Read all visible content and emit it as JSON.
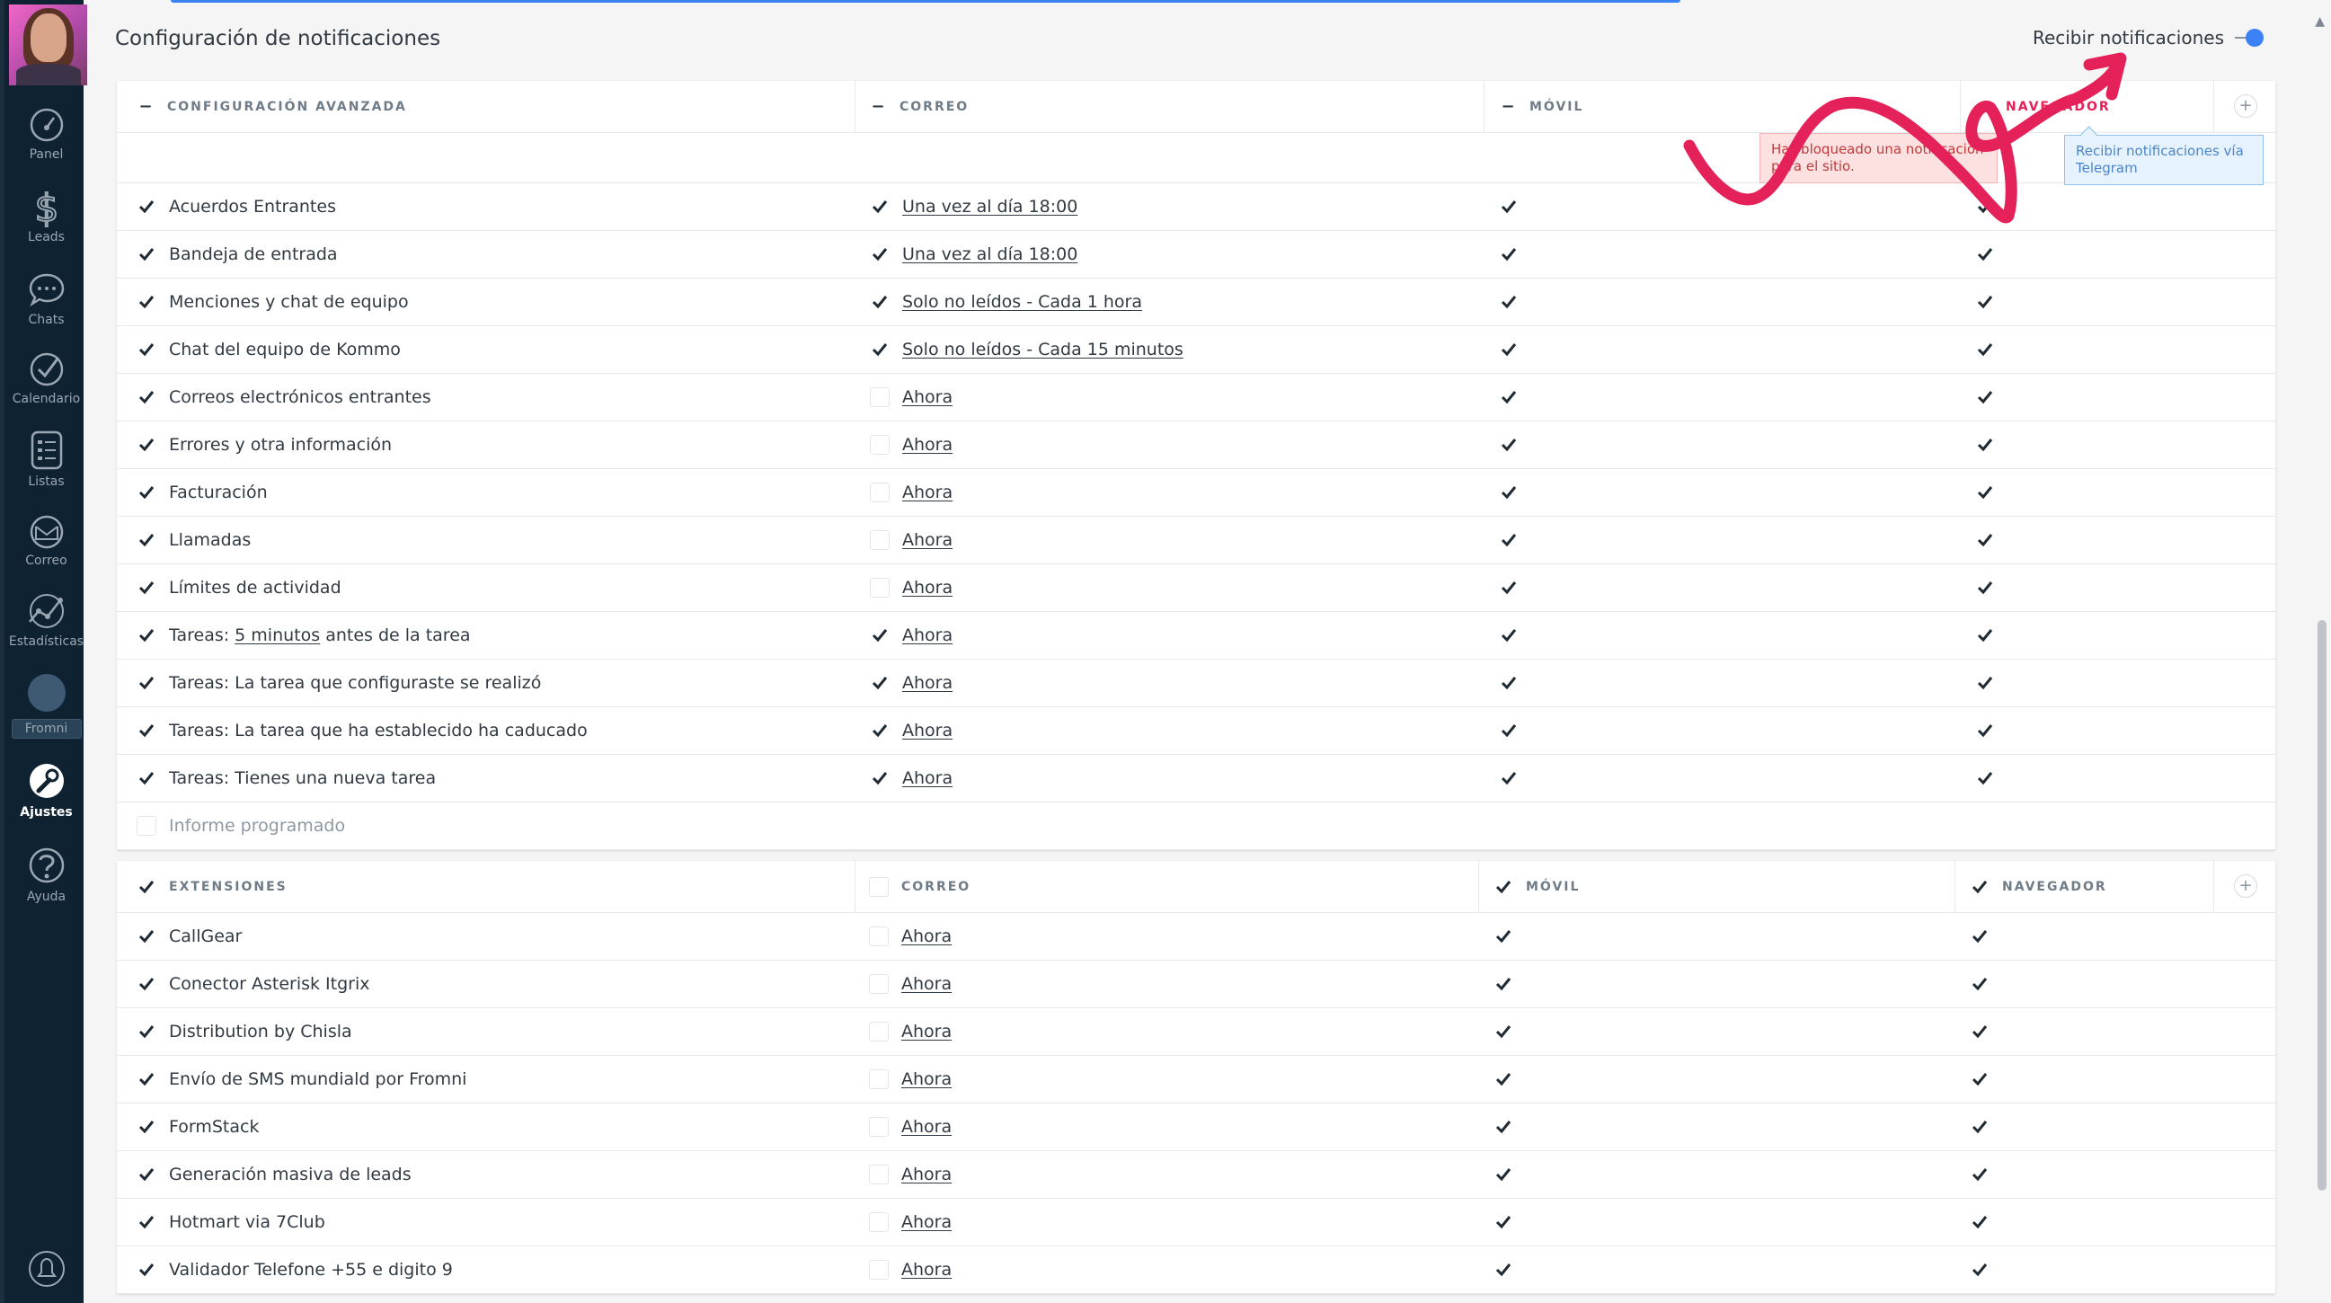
{
  "sidebar": {
    "items": [
      {
        "label": "Panel",
        "icon": "gauge-icon"
      },
      {
        "label": "Leads",
        "icon": "dollar-icon"
      },
      {
        "label": "Chats",
        "icon": "chat-icon"
      },
      {
        "label": "Calendario",
        "icon": "check-circle-icon"
      },
      {
        "label": "Listas",
        "icon": "list-icon"
      },
      {
        "label": "Correo",
        "icon": "mail-icon"
      },
      {
        "label": "Estadísticas",
        "icon": "stats-icon"
      },
      {
        "label": "Fromni",
        "icon": "fromni-icon"
      },
      {
        "label": "Ajustes",
        "icon": "wrench-icon",
        "active": true
      },
      {
        "label": "Ayuda",
        "icon": "help-icon"
      }
    ]
  },
  "page": {
    "title": "Configuración de notificaciones",
    "receive_label": "Recibir notificaciones",
    "toggle_on": true,
    "accent_color": "#3b82f6",
    "annotation_color": "#e5215a"
  },
  "advanced": {
    "headers": {
      "config": "CONFIGURACIÓN AVANZADA",
      "email": "CORREO",
      "mobile": "MÓVIL",
      "browser": "NAVEGADOR"
    },
    "tooltip_blocked": "Has bloqueado una notificación para el sitio.",
    "tooltip_telegram": "Recibir notificaciones vía Telegram",
    "rows": [
      {
        "name": "Acuerdos Entrantes",
        "enabled": true,
        "email_checked": true,
        "freq": "Una vez al día 18:00",
        "mobile": true,
        "browser": true
      },
      {
        "name": "Bandeja de entrada",
        "enabled": true,
        "email_checked": true,
        "freq": "Una vez al día 18:00",
        "mobile": true,
        "browser": true
      },
      {
        "name": "Menciones y chat de equipo",
        "enabled": true,
        "email_checked": true,
        "freq": "Solo no leídos - Cada 1 hora",
        "mobile": true,
        "browser": true
      },
      {
        "name": "Chat del equipo de Kommo",
        "enabled": true,
        "email_checked": true,
        "freq": "Solo no leídos - Cada 15 minutos",
        "mobile": true,
        "browser": true
      },
      {
        "name": "Correos electrónicos entrantes",
        "enabled": true,
        "email_checked": false,
        "freq": "Ahora",
        "mobile": true,
        "browser": true
      },
      {
        "name": "Errores y otra información",
        "enabled": true,
        "email_checked": false,
        "freq": "Ahora",
        "mobile": true,
        "browser": true
      },
      {
        "name": "Facturación",
        "enabled": true,
        "email_checked": false,
        "freq": "Ahora",
        "mobile": true,
        "browser": true
      },
      {
        "name": "Llamadas",
        "enabled": true,
        "email_checked": false,
        "freq": "Ahora",
        "mobile": true,
        "browser": true
      },
      {
        "name": "Límites de actividad",
        "enabled": true,
        "email_checked": false,
        "freq": "Ahora",
        "mobile": true,
        "browser": true
      },
      {
        "name_prefix": "Tareas: ",
        "name_link": "5 minutos",
        "name_suffix": " antes de la tarea",
        "enabled": true,
        "email_checked": true,
        "freq": "Ahora",
        "mobile": true,
        "browser": true
      },
      {
        "name": "Tareas: La tarea que configuraste se realizó",
        "enabled": true,
        "email_checked": true,
        "freq": "Ahora",
        "mobile": true,
        "browser": true
      },
      {
        "name": "Tareas: La tarea que ha establecido ha caducado",
        "enabled": true,
        "email_checked": true,
        "freq": "Ahora",
        "mobile": true,
        "browser": true
      },
      {
        "name": "Tareas: Tienes una nueva tarea",
        "enabled": true,
        "email_checked": true,
        "freq": "Ahora",
        "mobile": true,
        "browser": true
      },
      {
        "name": "Informe programado",
        "enabled": false,
        "muted": true
      }
    ]
  },
  "extensions": {
    "headers": {
      "config": "EXTENSIONES",
      "email": "CORREO",
      "mobile": "MÓVIL",
      "browser": "NAVEGADOR"
    },
    "rows": [
      {
        "name": "CallGear",
        "enabled": true,
        "email_checked": false,
        "freq": "Ahora",
        "mobile": true,
        "browser": true
      },
      {
        "name": "Conector Asterisk Itgrix",
        "enabled": true,
        "email_checked": false,
        "freq": "Ahora",
        "mobile": true,
        "browser": true
      },
      {
        "name": "Distribution by Chisla",
        "enabled": true,
        "email_checked": false,
        "freq": "Ahora",
        "mobile": true,
        "browser": true
      },
      {
        "name": "Envío de SMS mundiald por Fromni",
        "enabled": true,
        "email_checked": false,
        "freq": "Ahora",
        "mobile": true,
        "browser": true
      },
      {
        "name": "FormStack",
        "enabled": true,
        "email_checked": false,
        "freq": "Ahora",
        "mobile": true,
        "browser": true
      },
      {
        "name": "Generación masiva de leads",
        "enabled": true,
        "email_checked": false,
        "freq": "Ahora",
        "mobile": true,
        "browser": true
      },
      {
        "name": "Hotmart via 7Club",
        "enabled": true,
        "email_checked": false,
        "freq": "Ahora",
        "mobile": true,
        "browser": true
      },
      {
        "name": "Validador Telefone +55 e digito 9",
        "enabled": true,
        "email_checked": false,
        "freq": "Ahora",
        "mobile": true,
        "browser": true
      }
    ]
  }
}
